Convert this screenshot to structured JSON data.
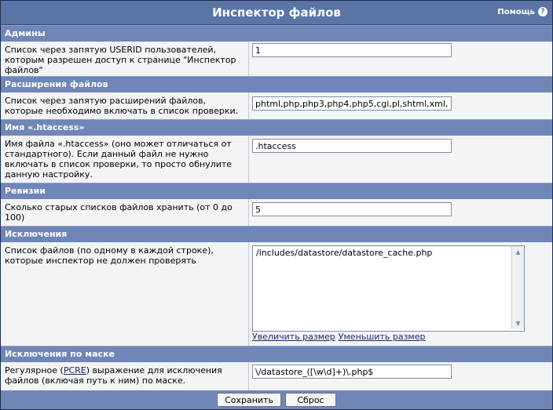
{
  "window": {
    "title": "Инспектор файлов",
    "help_label": "Помощь",
    "help_icon": "?"
  },
  "sections": {
    "admins": {
      "header": "Админы",
      "label": "Список через запятую USERID пользователей, которым разрешен доступ к странице \"Инспектор файлов\"",
      "value": "1"
    },
    "extensions": {
      "header": "Расширения файлов",
      "label": "Список через запятую расширений файлов, которые необходимо включать в список проверки.",
      "value": "phtml,php,php3,php4,php5,cgi,pl,shtml,xml,"
    },
    "htaccess": {
      "header": "Имя «.htaccess»",
      "label": "Имя файла «.htaccess» (оно может отличаться от стандартного). Если данный файл не нужно включать в список проверки, то просто обнулите данную настройку.",
      "value": ".htaccess"
    },
    "revisions": {
      "header": "Ревизии",
      "label": "Сколько старых списков файлов хранить (от 0 до 100)",
      "value": "5"
    },
    "exclusions": {
      "header": "Исключения",
      "label": "Список файлов (по одному в каждой строке), которые инспектор не должен проверять",
      "value": "/includes/datastore/datastore_cache.php",
      "increase_label": "Увеличить размер",
      "decrease_label": "Уменьшить размер"
    },
    "mask": {
      "header": "Исключения по маске",
      "label_before": "Регулярное (",
      "label_link": "PCRE",
      "label_after": ") выражение для исключения файлов (включая путь к ним) по маске.",
      "value": "\\/datastore_([\\w\\d]+)\\.php$"
    }
  },
  "footer": {
    "save_label": "Сохранить",
    "reset_label": "Сброс"
  },
  "scrollbar": {
    "up_icon": "▲",
    "down_icon": "▼"
  }
}
